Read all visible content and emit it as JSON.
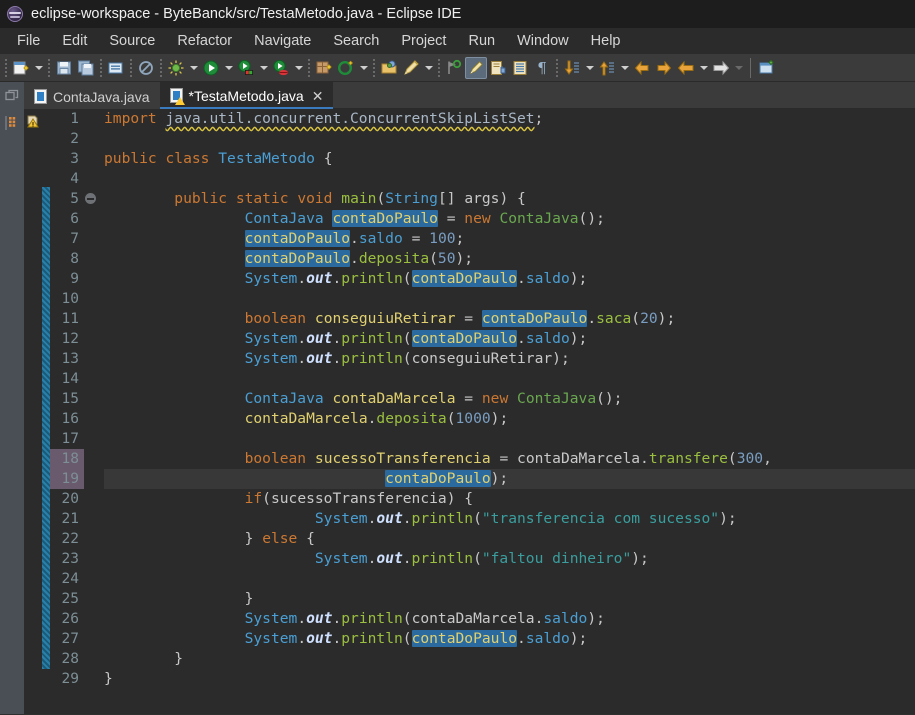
{
  "window": {
    "title": "eclipse-workspace - ByteBanck/src/TestaMetodo.java - Eclipse IDE",
    "logo_icon": "eclipse-logo-icon"
  },
  "menubar": {
    "items": [
      {
        "label": "File"
      },
      {
        "label": "Edit"
      },
      {
        "label": "Source"
      },
      {
        "label": "Refactor"
      },
      {
        "label": "Navigate"
      },
      {
        "label": "Search"
      },
      {
        "label": "Project"
      },
      {
        "label": "Run"
      },
      {
        "label": "Window"
      },
      {
        "label": "Help"
      }
    ]
  },
  "toolbar": {
    "buttons": [
      {
        "name": "new-wizard-icon",
        "glyph": "📄"
      },
      {
        "name": "save-icon",
        "glyph": "💾"
      },
      {
        "name": "save-all-icon",
        "glyph": "🗂"
      },
      {
        "name": "print-icon",
        "glyph": "🖶"
      },
      {
        "name": "no-quick-access-icon",
        "glyph": "⊘"
      },
      {
        "name": "debug-icon",
        "glyph": "✺"
      },
      {
        "name": "run-icon",
        "glyph": "▶"
      },
      {
        "name": "run-external-tools-icon",
        "glyph": "▶"
      },
      {
        "name": "run-coverage-icon",
        "glyph": "▶"
      },
      {
        "name": "new-java-package-icon",
        "glyph": "▦"
      },
      {
        "name": "new-java-class-icon",
        "glyph": "C"
      },
      {
        "name": "open-type-icon",
        "glyph": "📂"
      },
      {
        "name": "search-icon",
        "glyph": "✒"
      },
      {
        "name": "skip-breakpoints-icon",
        "glyph": "⚑"
      },
      {
        "name": "toggle-mark-occurrences-icon",
        "glyph": "✒"
      },
      {
        "name": "open-task-icon",
        "glyph": "⎘"
      },
      {
        "name": "show-whitespace-icon",
        "glyph": "▤"
      },
      {
        "name": "pilcrow-icon",
        "glyph": "¶"
      },
      {
        "name": "next-annotation-icon",
        "glyph": "↓"
      },
      {
        "name": "previous-annotation-icon",
        "glyph": "↑"
      },
      {
        "name": "back-icon",
        "glyph": "⇦"
      },
      {
        "name": "forward-icon",
        "glyph": "⇨"
      },
      {
        "name": "previous-edit-icon",
        "glyph": "←"
      },
      {
        "name": "next-edit-icon",
        "glyph": "→"
      },
      {
        "name": "open-perspective-icon",
        "glyph": "⧉"
      }
    ]
  },
  "tabs": [
    {
      "label": "ContaJava.java",
      "active": false,
      "dirty": false,
      "icon": "java-file-icon"
    },
    {
      "label": "*TestaMetodo.java",
      "active": true,
      "dirty": true,
      "icon": "java-file-warning-icon",
      "close_label": "✕"
    }
  ],
  "editor": {
    "first_line": 1,
    "last_line": 29,
    "current_line": 19,
    "changed_lines": [
      18,
      19
    ],
    "folding_marker_line": 5,
    "warning_line": 1,
    "line_numbers": [
      "1",
      "2",
      "3",
      "4",
      "5",
      "6",
      "7",
      "8",
      "9",
      "10",
      "11",
      "12",
      "13",
      "14",
      "15",
      "16",
      "17",
      "18",
      "19",
      "20",
      "21",
      "22",
      "23",
      "24",
      "25",
      "26",
      "27",
      "28",
      "29"
    ],
    "lines": [
      {
        "n": 1,
        "text": "import java.util.concurrent.ConcurrentSkipListSet;"
      },
      {
        "n": 2,
        "text": ""
      },
      {
        "n": 3,
        "text": "public class TestaMetodo {"
      },
      {
        "n": 4,
        "text": ""
      },
      {
        "n": 5,
        "text": "        public static void main(String[] args) {"
      },
      {
        "n": 6,
        "text": "                ContaJava contaDoPaulo = new ContaJava();"
      },
      {
        "n": 7,
        "text": "                contaDoPaulo.saldo = 100;"
      },
      {
        "n": 8,
        "text": "                contaDoPaulo.deposita(50);"
      },
      {
        "n": 9,
        "text": "                System.out.println(contaDoPaulo.saldo);"
      },
      {
        "n": 10,
        "text": ""
      },
      {
        "n": 11,
        "text": "                boolean conseguiuRetirar = contaDoPaulo.saca(20);"
      },
      {
        "n": 12,
        "text": "                System.out.println(contaDoPaulo.saldo);"
      },
      {
        "n": 13,
        "text": "                System.out.println(conseguiuRetirar);"
      },
      {
        "n": 14,
        "text": ""
      },
      {
        "n": 15,
        "text": "                ContaJava contaDaMarcela = new ContaJava();"
      },
      {
        "n": 16,
        "text": "                contaDaMarcela.deposita(1000);"
      },
      {
        "n": 17,
        "text": ""
      },
      {
        "n": 18,
        "text": "                boolean sucessoTransferencia = contaDaMarcela.transfere(300,"
      },
      {
        "n": 19,
        "text": "                                contaDoPaulo);"
      },
      {
        "n": 20,
        "text": "                if(sucessoTransferencia) {"
      },
      {
        "n": 21,
        "text": "                        System.out.println(\"transferencia com sucesso\");"
      },
      {
        "n": 22,
        "text": "                } else {"
      },
      {
        "n": 23,
        "text": "                        System.out.println(\"faltou dinheiro\");"
      },
      {
        "n": 24,
        "text": ""
      },
      {
        "n": 25,
        "text": "                }"
      },
      {
        "n": 26,
        "text": "                System.out.println(contaDaMarcela.saldo);"
      },
      {
        "n": 27,
        "text": "                System.out.println(contaDoPaulo.saldo);"
      },
      {
        "n": 28,
        "text": "        }"
      },
      {
        "n": 29,
        "text": "}"
      }
    ],
    "highlighted_occurrence": "contaDoPaulo"
  },
  "colors": {
    "background": "#2b2b2b",
    "keyword": "#cc7832",
    "type": "#4a9fd4",
    "variable": "#e0d070",
    "method": "#9bbf3f",
    "number": "#7a9ec2",
    "string": "#3a9e9e",
    "occurrence_highlight": "#2a6a9e",
    "current_line": "#383838",
    "change_bar": "#2a7fa8",
    "tab_active_underline": "#3a7bbf",
    "title_bar": "#1d1d1d",
    "menu_bar": "#2b2b2b",
    "toolbar": "#3b3b3b"
  }
}
